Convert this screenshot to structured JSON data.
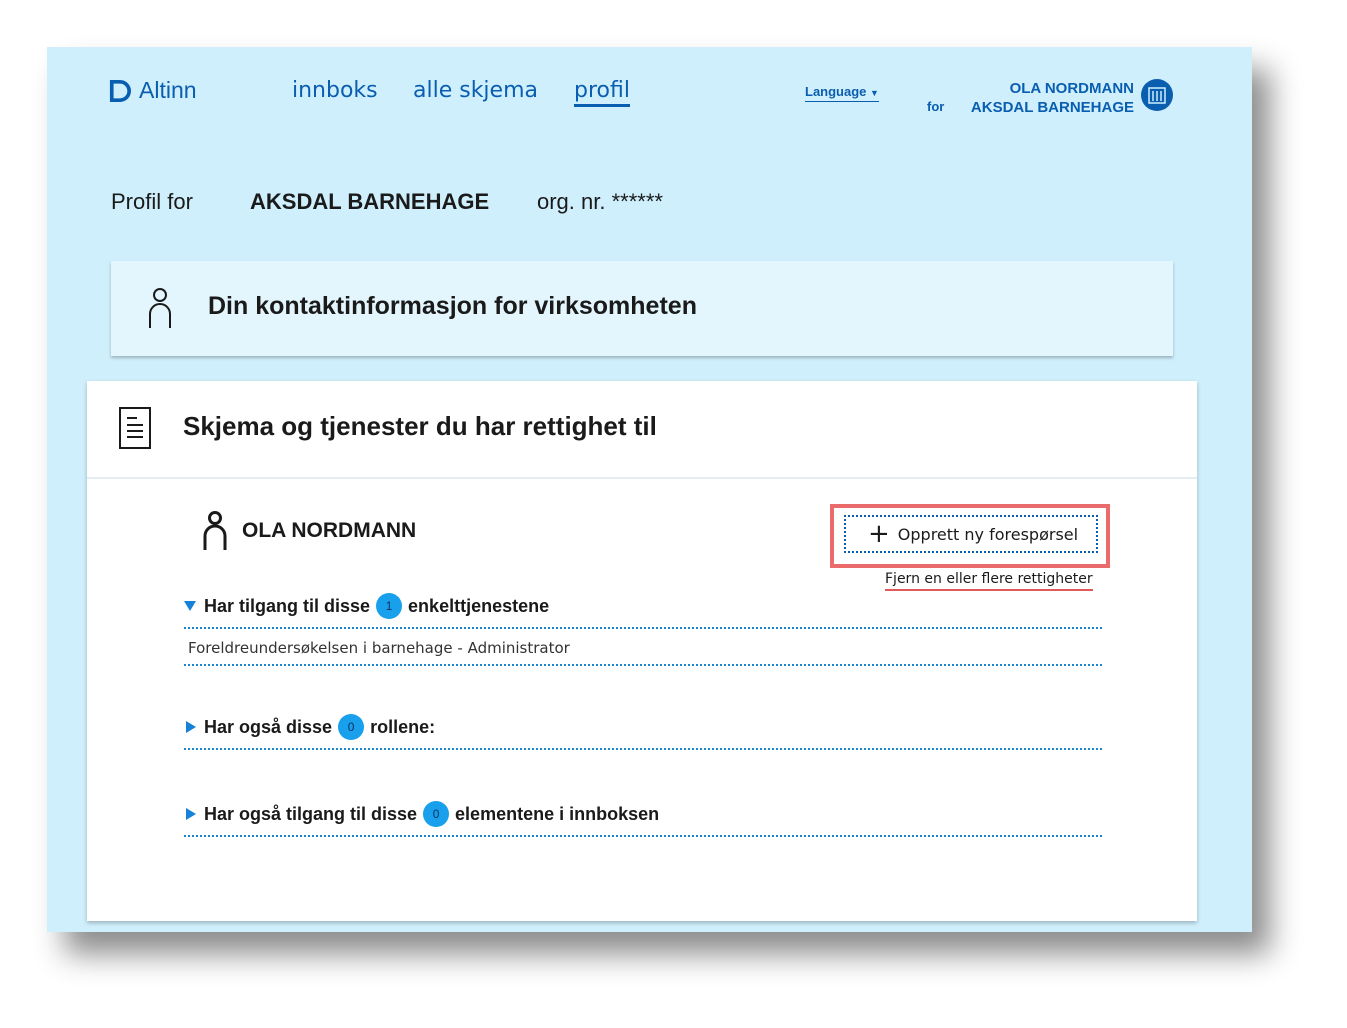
{
  "header": {
    "logo_text": "Altinn",
    "nav": [
      {
        "label": "innboks",
        "active": false
      },
      {
        "label": "alle skjema",
        "active": false
      },
      {
        "label": "profil",
        "active": true
      }
    ],
    "language_label": "Language",
    "for_label": "for",
    "user_name": "OLA NORDMANN",
    "org_name": "AKSDAL BARNEHAGE",
    "accent_color": "#0a5eb0"
  },
  "profile": {
    "prefix": "Profil for",
    "org_name": "AKSDAL BARNEHAGE",
    "org_nr": "org. nr. ******"
  },
  "contact_card": {
    "title": "Din kontaktinformasjon for virksomheten",
    "icon": "person-icon"
  },
  "services": {
    "title": "Skjema og tjenester du har rettighet til",
    "icon": "document-icon",
    "person_name": "OLA NORDMANN",
    "new_request_label": "Opprett ny forespørsel",
    "remove_rights_label": "Fjern en eller flere rettigheter",
    "highlight_color": "#ea6b6b",
    "sections": [
      {
        "prefix": "Har tilgang til disse",
        "count": "1",
        "suffix": "enkelttjenestene",
        "expanded": true,
        "items": [
          "Foreldreundersøkelsen i barnehage - Administrator"
        ]
      },
      {
        "prefix": "Har også disse",
        "count": "0",
        "suffix": "rollene:",
        "expanded": false,
        "items": []
      },
      {
        "prefix": "Har også tilgang til disse",
        "count": "0",
        "suffix": "elementene i innboksen",
        "expanded": false,
        "items": []
      }
    ]
  }
}
